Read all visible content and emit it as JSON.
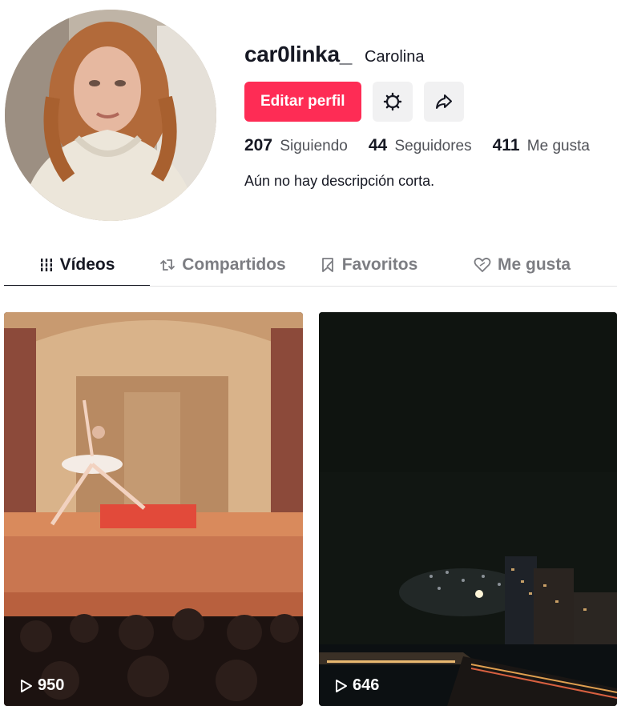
{
  "profile": {
    "username": "car0linka_",
    "nickname": "Carolina",
    "edit_label": "Editar perfil",
    "stats": {
      "following_count": "207",
      "following_label": "Siguiendo",
      "followers_count": "44",
      "followers_label": "Seguidores",
      "likes_count": "411",
      "likes_label": "Me gusta"
    },
    "bio": "Aún no hay descripción corta."
  },
  "tabs": [
    {
      "label": "Vídeos",
      "icon": "grid-icon"
    },
    {
      "label": "Compartidos",
      "icon": "repost-icon"
    },
    {
      "label": "Favoritos",
      "icon": "bookmark-icon"
    },
    {
      "label": "Me gusta",
      "icon": "heart-icon"
    }
  ],
  "videos": [
    {
      "views": "950"
    },
    {
      "views": "646"
    }
  ],
  "colors": {
    "accent": "#fe2c55",
    "text": "#161823",
    "muted": "#7c7d82"
  }
}
